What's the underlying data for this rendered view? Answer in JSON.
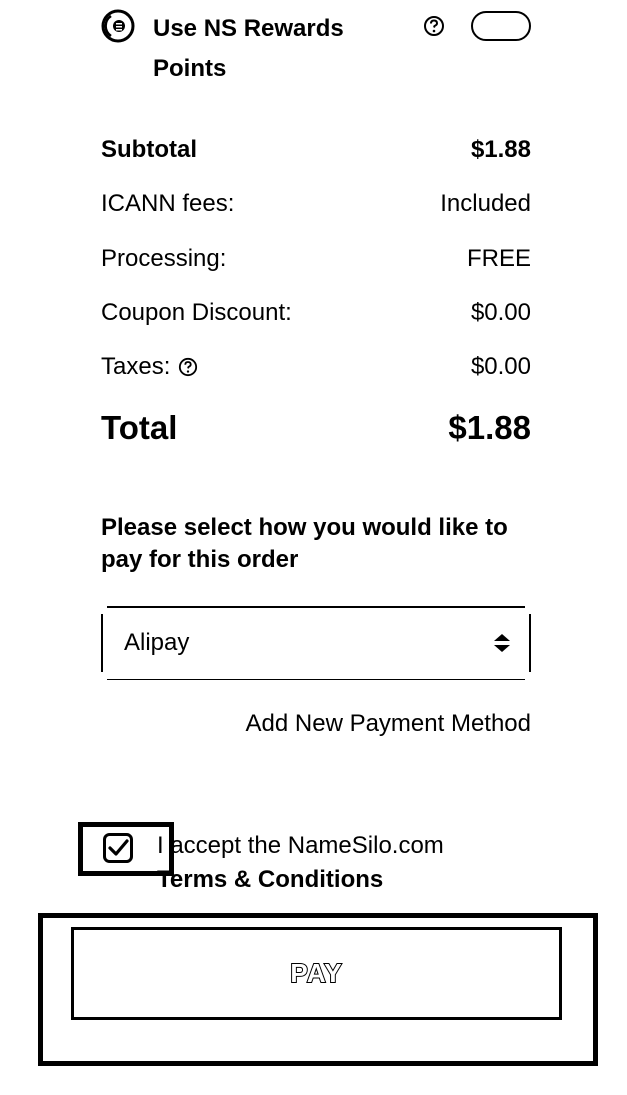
{
  "rewards": {
    "label": "Use NS Rewards Points",
    "toggle_on": false
  },
  "summary": {
    "rows": [
      {
        "label": "Subtotal",
        "value": "$1.88",
        "bold": true
      },
      {
        "label": "ICANN fees:",
        "value": "Included"
      },
      {
        "label": "Processing:",
        "value": "FREE"
      },
      {
        "label": "Coupon Discount:",
        "value": "$0.00"
      },
      {
        "label": "Taxes:",
        "value": "$0.00",
        "help": true
      }
    ],
    "total_label": "Total",
    "total_value": "$1.88"
  },
  "payment": {
    "heading": "Please select how you would like to pay for this order",
    "selected_method": "Alipay",
    "add_method_label": "Add New Payment Method"
  },
  "terms": {
    "checked": true,
    "text": "I accept the NameSilo.com",
    "link": "Terms & Conditions"
  },
  "pay_button": {
    "label": "PAY"
  },
  "icons": {
    "rewards": "coin-icon",
    "help": "question-circle-icon",
    "select": "sort-arrows-icon",
    "check": "checkbox-checked-icon"
  }
}
